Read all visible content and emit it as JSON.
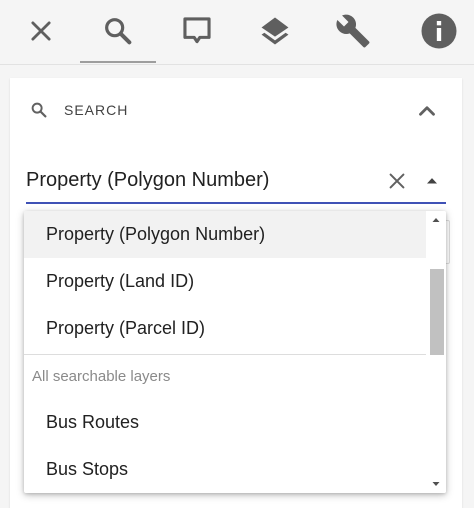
{
  "toolbar": {
    "tools": [
      {
        "name": "close-tool",
        "icon": "close-icon",
        "active": false
      },
      {
        "name": "search-tool",
        "icon": "search-icon",
        "active": true
      },
      {
        "name": "comment-tool",
        "icon": "comment-icon",
        "active": false
      },
      {
        "name": "layers-tool",
        "icon": "layers-icon",
        "active": false
      },
      {
        "name": "settings-tool",
        "icon": "wrench-icon",
        "active": false
      },
      {
        "name": "info-tool",
        "icon": "info-icon",
        "active": false
      }
    ]
  },
  "panel": {
    "header_label": "SEARCH",
    "header_icon": "search-icon",
    "collapse_icon": "chevron-up-icon"
  },
  "select": {
    "value": "Property (Polygon Number)",
    "clear_icon": "close-icon",
    "toggle_icon": "arrow-drop-up-icon"
  },
  "dropdown": {
    "items": [
      {
        "label": "Property (Polygon Number)",
        "highlighted": true
      },
      {
        "label": "Property (Land ID)",
        "highlighted": false
      },
      {
        "label": "Property (Parcel ID)",
        "highlighted": false
      }
    ],
    "group_label": "All searchable layers",
    "group_items": [
      {
        "label": "Bus Routes"
      },
      {
        "label": "Bus Stops"
      }
    ]
  },
  "colors": {
    "accent": "#3f51b5",
    "icon": "#5f5f5f",
    "background": "#f5f5f5"
  }
}
